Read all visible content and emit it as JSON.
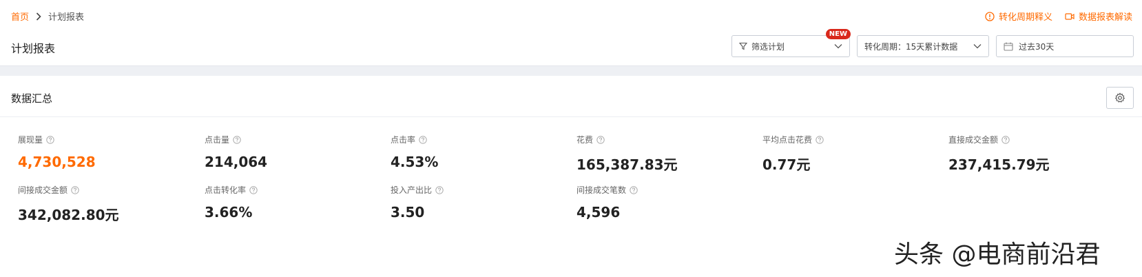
{
  "breadcrumb": {
    "home": "首页",
    "current": "计划报表"
  },
  "page_title": "计划报表",
  "help_links": {
    "period_help": "转化周期释义",
    "report_help": "数据报表解读"
  },
  "toolbar": {
    "filter_label": "筛选计划",
    "filter_badge": "NEW",
    "period_select": "转化周期：15天累计数据",
    "date_range": "过去30天"
  },
  "summary": {
    "title": "数据汇总",
    "metrics": [
      {
        "label": "展现量",
        "value": "4,730,528"
      },
      {
        "label": "点击量",
        "value": "214,064"
      },
      {
        "label": "点击率",
        "value": "4.53%"
      },
      {
        "label": "花费",
        "value": "165,387.83元"
      },
      {
        "label": "平均点击花费",
        "value": "0.77元"
      },
      {
        "label": "直接成交金额",
        "value": "237,415.79元"
      },
      {
        "label": "间接成交金额",
        "value": "342,082.80元"
      },
      {
        "label": "点击转化率",
        "value": "3.66%"
      },
      {
        "label": "投入产出比",
        "value": "3.50"
      },
      {
        "label": "间接成交笔数",
        "value": "4,596"
      }
    ]
  },
  "watermark": "头条 @电商前沿君",
  "colors": {
    "accent": "#ff6a00",
    "badge": "#d9281b"
  }
}
